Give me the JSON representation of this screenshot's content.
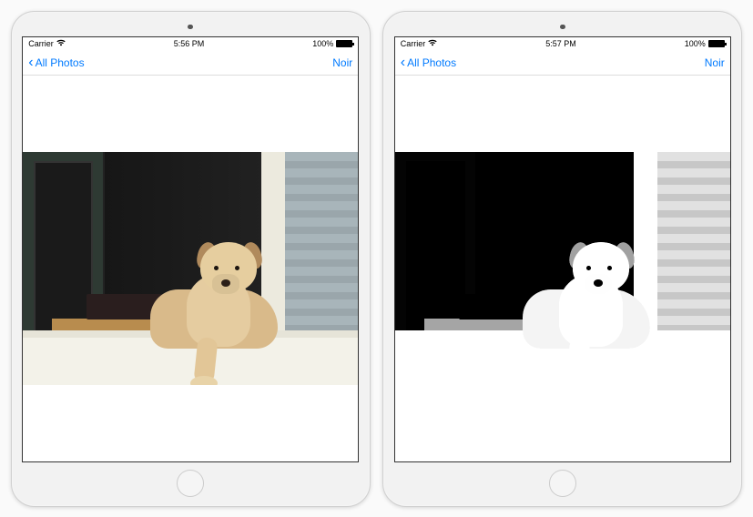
{
  "devices": [
    {
      "status": {
        "carrier": "Carrier",
        "time": "5:56 PM",
        "battery_pct": "100%"
      },
      "nav": {
        "back_label": "All Photos",
        "action_label": "Noir"
      },
      "photo_style": "color"
    },
    {
      "status": {
        "carrier": "Carrier",
        "time": "5:57 PM",
        "battery_pct": "100%"
      },
      "nav": {
        "back_label": "All Photos",
        "action_label": "Noir"
      },
      "photo_style": "noir"
    }
  ]
}
